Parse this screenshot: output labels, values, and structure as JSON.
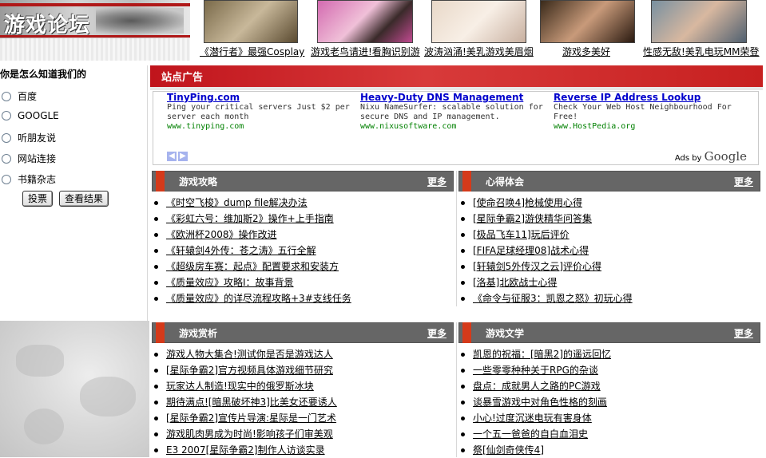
{
  "header": {
    "logo_title": "游戏论坛",
    "thumbnails": [
      {
        "caption": "《潜行者》最强Cosplay"
      },
      {
        "caption": "游戏老鸟请进!看胸识别游"
      },
      {
        "caption": "波涛汹涌!美乳游戏美眉烟"
      },
      {
        "caption": "游戏多美好"
      },
      {
        "caption": "性感无敌!美乳电玩MM荣登"
      }
    ]
  },
  "poll": {
    "question": "你是怎么知道我们的",
    "options": [
      "百度",
      "GOOGLE",
      "听朋友说",
      "网站连接",
      "书籍杂志"
    ],
    "vote_label": "投票",
    "results_label": "查看结果"
  },
  "ads": {
    "section_title": "站点广告",
    "items": [
      {
        "title": "TinyPing.com",
        "desc": "Ping your critical servers Just $2 per server each month",
        "url": "www.tinyping.com"
      },
      {
        "title": "Heavy-Duty DNS Management",
        "desc": "Nixu NameSurfer: scalable solution for secure DNS and IP management.",
        "url": "www.nixusoftware.com"
      },
      {
        "title": "Reverse IP Address Lookup",
        "desc": "Check Your Web Host Neighbourhood For Free!",
        "url": "www.HostPedia.org"
      }
    ],
    "ads_by": "Ads by",
    "google": "Google"
  },
  "panels": {
    "gonglue": {
      "title": "游戏攻略",
      "more": "更多",
      "items": [
        "《时空飞梭》dump file解决办法",
        "《彩虹六号：维加斯2》操作+上手指南",
        "《欧洲杯2008》操作改进",
        "《轩辕剑4外传：苍之涛》五行全解",
        "《超级房车赛：起点》配置要求和安装方",
        "《质量效应》攻略I：故事背景",
        "《质量效应》的详尽流程攻略+3#支线任务"
      ]
    },
    "xinde": {
      "title": "心得体会",
      "more": "更多",
      "items": [
        "[使命召唤4]枪械使用心得",
        "[星际争霸2]游侠精华问答集",
        "[极品飞车11]玩后评价",
        "[FIFA足球经理08]战术心得",
        "[轩辕剑5外传汉之云]评价心得",
        "[洛基]北欧战士心得",
        "《命令与征服3：凯恩之怒》初玩心得"
      ]
    },
    "shangxi": {
      "title": "游戏赏析",
      "more": "更多",
      "items": [
        "游戏人物大集合!测试你是否是游戏达人",
        "[星际争霸2]官方视频具体游戏细节研究",
        "玩家达人制造!现实中的俄罗斯冰块",
        "期待满点![暗黑破坏神3]比美女还要诱人",
        "[星际争霸2]宣传片导演:星际是一门艺术",
        "游戏肌肉男成为时尚!影响孩子们审美观",
        "E3 2007[星际争霸2]制作人访谈实录"
      ]
    },
    "wenxue": {
      "title": "游戏文学",
      "more": "更多",
      "items": [
        "凯恩的祝福：[暗黑2]的遥远回忆",
        "一些零零种种关于RPG的杂谈",
        "盘点：成就男人之路的PC游戏",
        "谈暴雪游戏中对角色性格的刻画",
        "小心!过度沉迷电玩有害身体",
        "一个五一爸爸的自白血泪史",
        "祭[仙剑奇侠传4]"
      ]
    }
  }
}
